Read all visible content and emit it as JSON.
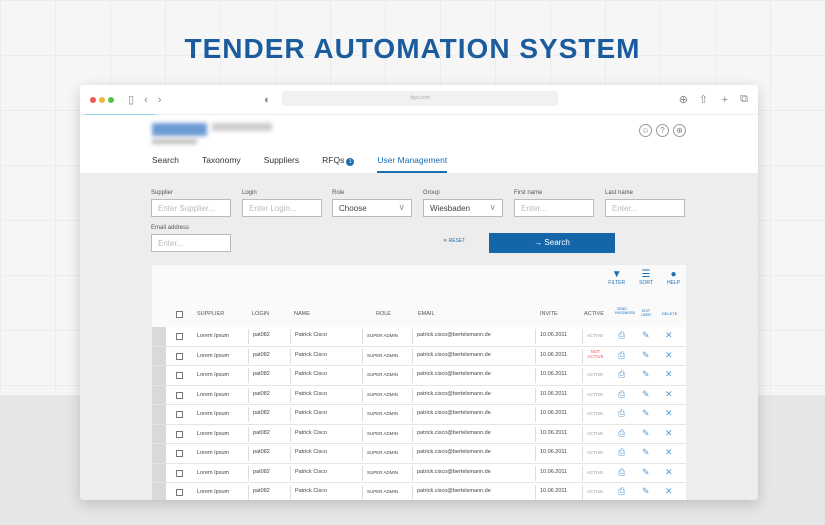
{
  "page_title": "TENDER AUTOMATION SYSTEM",
  "browser": {
    "url": "tjtys.com"
  },
  "nav": {
    "tabs": [
      "Search",
      "Taxonomy",
      "Suppliers",
      "RFQs",
      "User Management"
    ],
    "rfq_badge": "1"
  },
  "form": {
    "supplier": {
      "label": "Supplier",
      "placeholder": "Enter Supplier..."
    },
    "login": {
      "label": "Login",
      "placeholder": "Enter Login..."
    },
    "role": {
      "label": "Role",
      "value": "Choose"
    },
    "group": {
      "label": "Group",
      "value": "Wiesbaden"
    },
    "first_name": {
      "label": "First name",
      "placeholder": "Enter..."
    },
    "last_name": {
      "label": "Last name",
      "placeholder": "Enter..."
    },
    "email": {
      "label": "Email address",
      "placeholder": "Enter..."
    },
    "reset": "✕ RESET",
    "search": "→  Search"
  },
  "tools": {
    "filter": "FILTER",
    "sort": "SORT",
    "help": "HELP"
  },
  "table": {
    "headers": {
      "supplier": "SUPPLIER",
      "login": "LOGIN",
      "name": "NAME",
      "role": "ROLE",
      "email": "EMAIL",
      "invite": "INVITE",
      "active": "ACTIVE",
      "send": "SEND PASSWORD",
      "edit": "EDIT USER",
      "delete": "DELETE"
    },
    "rows": [
      {
        "supplier": "Lorem Ipsum",
        "login": "pat082",
        "name": "Patrick Cisco",
        "role": "SUPER ADMIN",
        "email": "patrick.cisco@bertelsmann.de",
        "invite": "10.06.2011",
        "active": "ACTIVE"
      },
      {
        "supplier": "Lorem Ipsum",
        "login": "pat082",
        "name": "Patrick Cisco",
        "role": "SUPER ADMIN",
        "email": "patrick.cisco@bertelsmann.de",
        "invite": "10.06.2011",
        "active": "NOT ACTIVE"
      },
      {
        "supplier": "Lorem Ipsum",
        "login": "pat082",
        "name": "Patrick Cisco",
        "role": "SUPER ADMIN",
        "email": "patrick.cisco@bertelsmann.de",
        "invite": "10.06.2011",
        "active": "ACTIVE"
      },
      {
        "supplier": "Lorem Ipsum",
        "login": "pat082",
        "name": "Patrick Cisco",
        "role": "SUPER ADMIN",
        "email": "patrick.cisco@bertelsmann.de",
        "invite": "10.06.2011",
        "active": "ACTIVE"
      },
      {
        "supplier": "Lorem Ipsum",
        "login": "pat082",
        "name": "Patrick Cisco",
        "role": "SUPER ADMIN",
        "email": "patrick.cisco@bertelsmann.de",
        "invite": "10.06.2011",
        "active": "ACTIVE"
      },
      {
        "supplier": "Lorem Ipsum",
        "login": "pat082",
        "name": "Patrick Cisco",
        "role": "SUPER ADMIN",
        "email": "patrick.cisco@bertelsmann.de",
        "invite": "10.06.2011",
        "active": "ACTIVE"
      },
      {
        "supplier": "Lorem Ipsum",
        "login": "pat082",
        "name": "Patrick Cisco",
        "role": "SUPER ADMIN",
        "email": "patrick.cisco@bertelsmann.de",
        "invite": "10.06.2011",
        "active": "ACTIVE"
      },
      {
        "supplier": "Lorem Ipsum",
        "login": "pat082",
        "name": "Patrick Cisco",
        "role": "SUPER ADMIN",
        "email": "patrick.cisco@bertelsmann.de",
        "invite": "10.06.2011",
        "active": "ACTIVE"
      },
      {
        "supplier": "Lorem Ipsum",
        "login": "pat082",
        "name": "Patrick Cisco",
        "role": "SUPER ADMIN",
        "email": "patrick.cisco@bertelsmann.de",
        "invite": "10.06.2011",
        "active": "ACTIVE"
      }
    ]
  }
}
